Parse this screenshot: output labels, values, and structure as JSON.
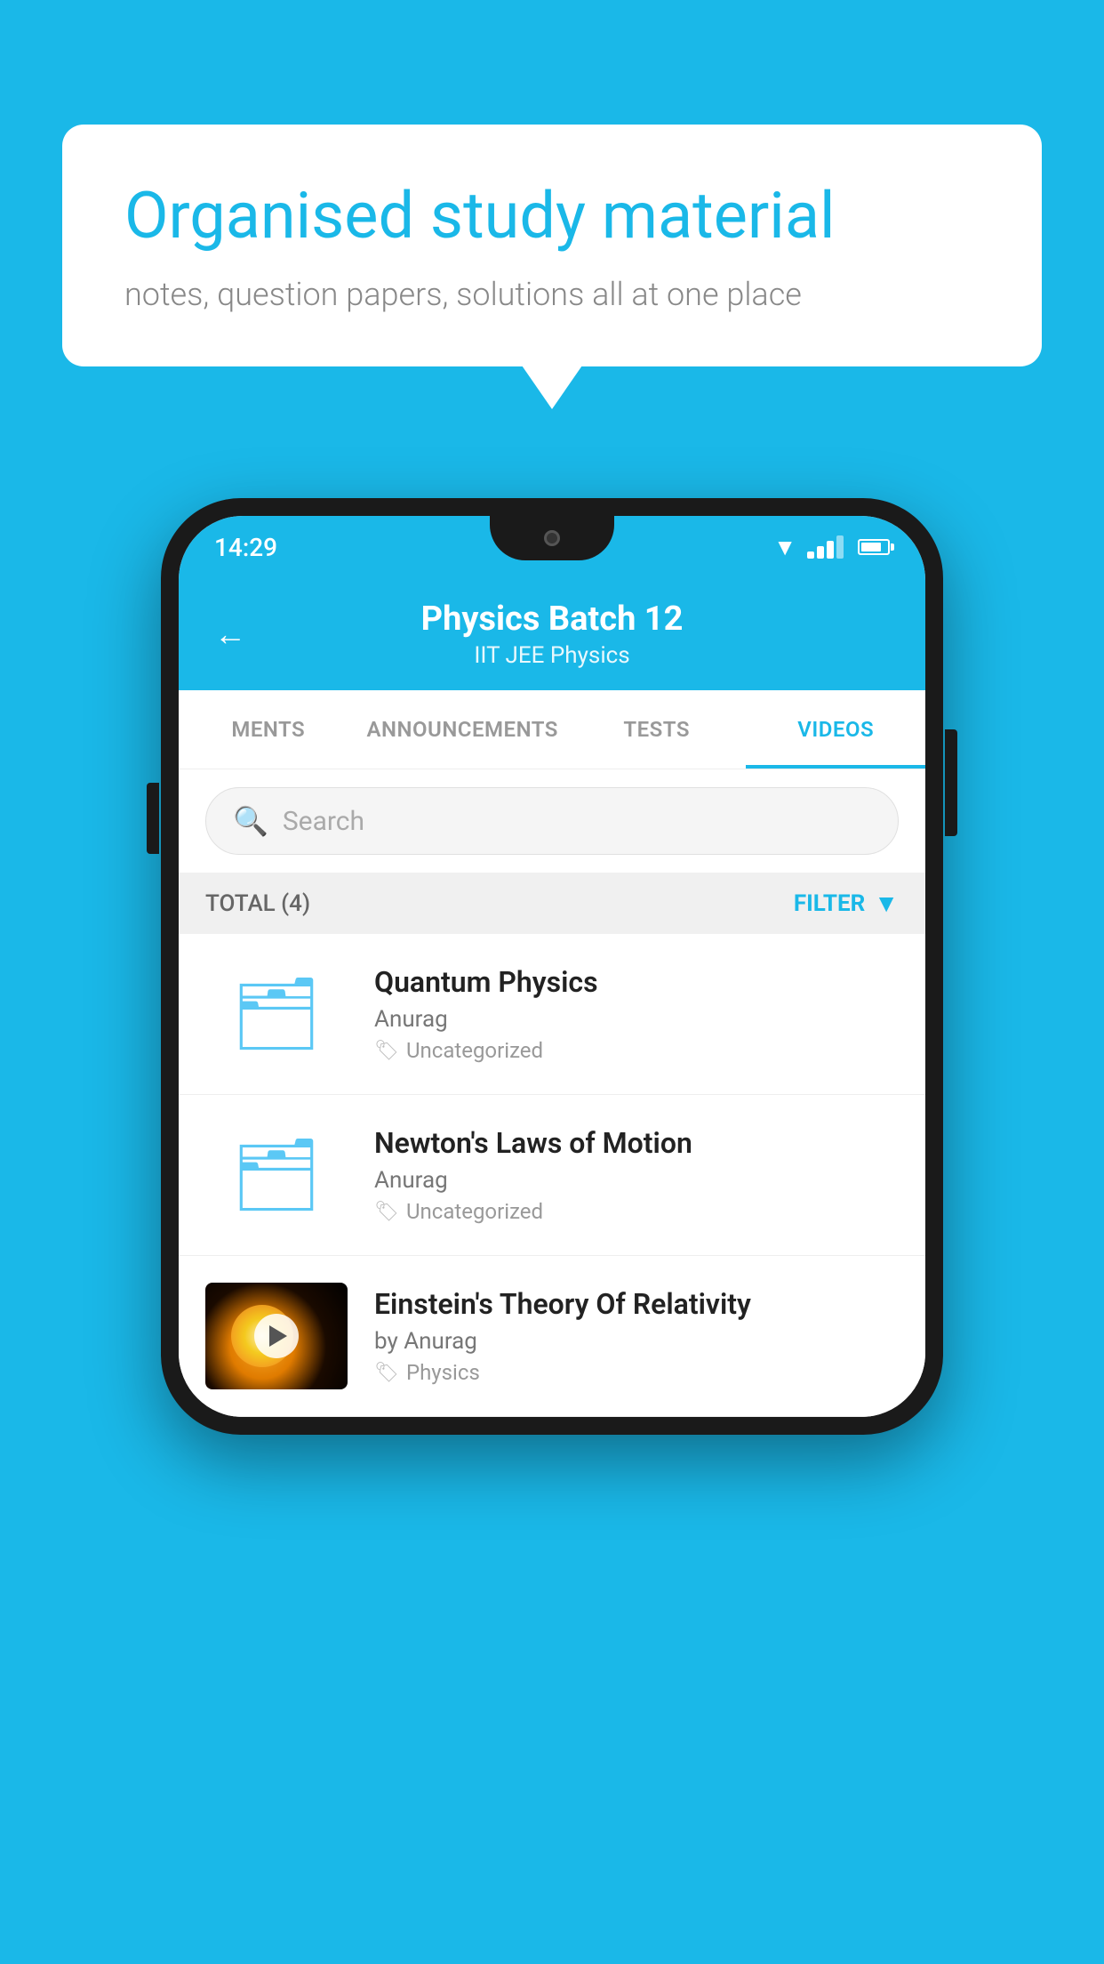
{
  "background_color": "#1ab8e8",
  "speech_bubble": {
    "headline": "Organised study material",
    "subtitle": "notes, question papers, solutions all at one place"
  },
  "phone": {
    "status_bar": {
      "time": "14:29"
    },
    "header": {
      "title": "Physics Batch 12",
      "subtitle": "IIT JEE   Physics",
      "back_label": "←"
    },
    "tabs": [
      {
        "label": "MENTS",
        "active": false
      },
      {
        "label": "ANNOUNCEMENTS",
        "active": false
      },
      {
        "label": "TESTS",
        "active": false
      },
      {
        "label": "VIDEOS",
        "active": true
      }
    ],
    "search": {
      "placeholder": "Search"
    },
    "filter_row": {
      "total_label": "TOTAL (4)",
      "filter_label": "FILTER"
    },
    "video_items": [
      {
        "id": 1,
        "title": "Quantum Physics",
        "author": "Anurag",
        "tag": "Uncategorized",
        "type": "folder"
      },
      {
        "id": 2,
        "title": "Newton's Laws of Motion",
        "author": "Anurag",
        "tag": "Uncategorized",
        "type": "folder"
      },
      {
        "id": 3,
        "title": "Einstein's Theory Of Relativity",
        "author": "by Anurag",
        "tag": "Physics",
        "type": "video"
      }
    ]
  }
}
